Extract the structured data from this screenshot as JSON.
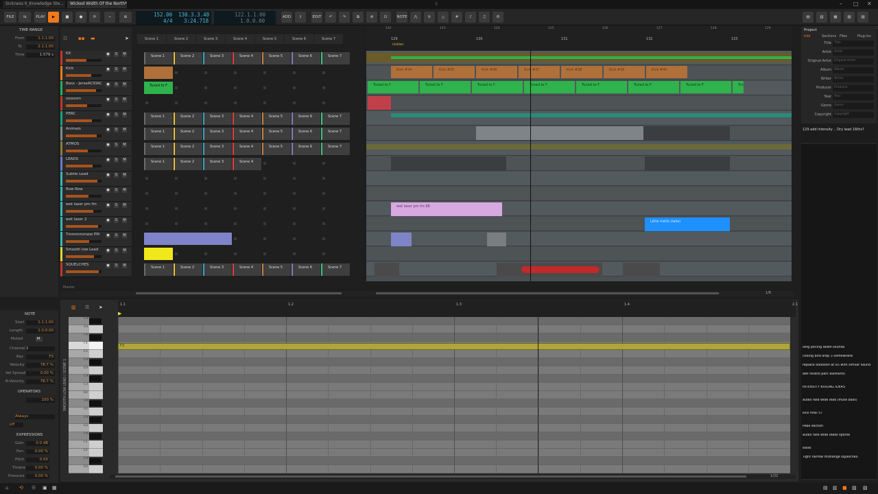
{
  "tabs": [
    "Sickness II_Knowledge Ste...",
    "Wicked Width Of the North*"
  ],
  "toolbar": {
    "file": "FILE",
    "play": "PLAY",
    "tempo": "152.00",
    "position": "130.3.3.48",
    "signature": "4/4",
    "time": "3:24.718",
    "loop_start": "122.1.1.00",
    "loop_len": "1.0.0.00",
    "add": "ADD",
    "edit": "EDIT",
    "note": "NOTE"
  },
  "time_range": {
    "title": "TIME RANGE",
    "from_label": "From",
    "from": "1.1.1.00",
    "to_label": "To",
    "to": "2.1.1.00",
    "time_label": "Time",
    "time": "1.579 s"
  },
  "scenes": [
    "Scene 1",
    "Scene 2",
    "Scene 3",
    "Scene 4",
    "Scene 5",
    "Scene 6",
    "Scene 7"
  ],
  "tracks": [
    {
      "name": "Kit",
      "color": "#c0392b"
    },
    {
      "name": "Kick",
      "color": "#e67e22"
    },
    {
      "name": "Bass - JerseACIDAC",
      "color": "#27ae60"
    },
    {
      "name": "ooooom",
      "color": "#c0392b"
    },
    {
      "name": "PERC",
      "color": "#16a085"
    },
    {
      "name": "Animals",
      "color": "#7f8c8d"
    },
    {
      "name": "ATMOS",
      "color": "#8e7d3a"
    },
    {
      "name": "LEADS",
      "color": "#6c7ad0"
    },
    {
      "name": "Subtle Lead",
      "color": "#3cb6b6"
    },
    {
      "name": "Row Row",
      "color": "#3cb6b6"
    },
    {
      "name": "wet laser pm fm",
      "color": "#3cb6b6"
    },
    {
      "name": "wet laser 2",
      "color": "#3cb6b6"
    },
    {
      "name": "Tmmmmmww PM",
      "color": "#3cb6b6"
    },
    {
      "name": "Smooth low Lead",
      "color": "#e0d83a"
    },
    {
      "name": "SQUELCHES",
      "color": "#c0392b"
    }
  ],
  "master": "Master",
  "arranger": {
    "bars": [
      "129",
      "130",
      "131",
      "132",
      "133"
    ],
    "top_ticks": [
      "122",
      "123",
      "124",
      "125",
      "126",
      "127",
      "128",
      "129",
      "130",
      "131"
    ],
    "clip_kick": [
      "Kick #34",
      "Kick #35",
      "Kick #36",
      "Kick #37",
      "Kick #38",
      "Kick #39",
      "Kick #40"
    ],
    "clip_bass": "Tuned to F",
    "clip_laser": "wet laser pm fm 88",
    "clip_blue": "Little mello (take)",
    "clip_tuned": "Tuned to F",
    "loop_marker": "Untitled",
    "zoom": "1/8"
  },
  "note_panel": {
    "title": "NOTE",
    "start_label": "Start",
    "start": "1.1.1.00",
    "length_label": "Length",
    "length": "1.0.0.00",
    "muted_label": "Muted",
    "muted": "M",
    "channel_label": "Channel",
    "channel": "1",
    "key_label": "Key",
    "key": "F3",
    "velocity_label": "Velocity",
    "velocity": "78.7 %",
    "velspread_label": "Vel Spread",
    "velspread": "0.00 %",
    "rvel_label": "R-Velocity",
    "rvel": "78.7 %",
    "operators_title": "OPERATORS",
    "op_pct": "100 %",
    "op_always": "Always",
    "op_off": "off",
    "expressions_title": "EXPRESSIONS",
    "gain_label": "Gain",
    "gain": "0.0 dB",
    "pan_label": "Pan",
    "pan": "0.00 %",
    "pitch_label": "Pitch",
    "pitch": "0.00",
    "timbre_label": "Timbre",
    "timbre": "0.00 %",
    "pressure_label": "Pressure",
    "pressure": "0.00 %"
  },
  "piano_roll": {
    "side_label": "SMOOTH LOW LEAD / SCENE 1",
    "bars": [
      "1.1",
      "1.2",
      "1.3",
      "1.4",
      "2.1"
    ],
    "keys": [
      "G#3",
      "G3",
      "F#3",
      "F3",
      "E3",
      "D#3",
      "D3",
      "C#3",
      "C3",
      "B2",
      "A#2",
      "A2",
      "G#2",
      "G2",
      "F#2",
      "F2",
      "E2",
      "D#2",
      "D2"
    ],
    "note_label": "F3",
    "zoom": "1/32"
  },
  "inspector": {
    "title": "Project",
    "tabs": [
      "Info",
      "Sections",
      "Files",
      "Plug-ins"
    ],
    "fields": [
      {
        "label": "Title",
        "placeholder": "Title"
      },
      {
        "label": "Artist",
        "placeholder": "Artist"
      },
      {
        "label": "Original Artist",
        "placeholder": "Original Artist"
      },
      {
        "label": "Album",
        "placeholder": "Album"
      },
      {
        "label": "Writer",
        "placeholder": "Writer"
      },
      {
        "label": "Producer",
        "placeholder": "Producer"
      },
      {
        "label": "Year",
        "placeholder": "Year"
      },
      {
        "label": "Genre",
        "placeholder": "Genre"
      },
      {
        "label": "Copyright",
        "placeholder": "Copyright"
      }
    ],
    "comment": "129 add intensity .. Dry lead 16ths?",
    "notes": [
      "long pitcing down sounds",
      "cooing bird drop 3 somewhere",
      "replace ooooooh at 65 with similar sound",
      "wet reverb perc elements",
      "",
      "INTENSITY BUILING IDEAS",
      "",
      "audio rate wide lead (mute bass)",
      "",
      "kick filtel 57",
      "",
      "Peak section",
      "audio rate wide leads sparse",
      "",
      "sssss",
      "Tight narrow midrange squelches."
    ]
  }
}
